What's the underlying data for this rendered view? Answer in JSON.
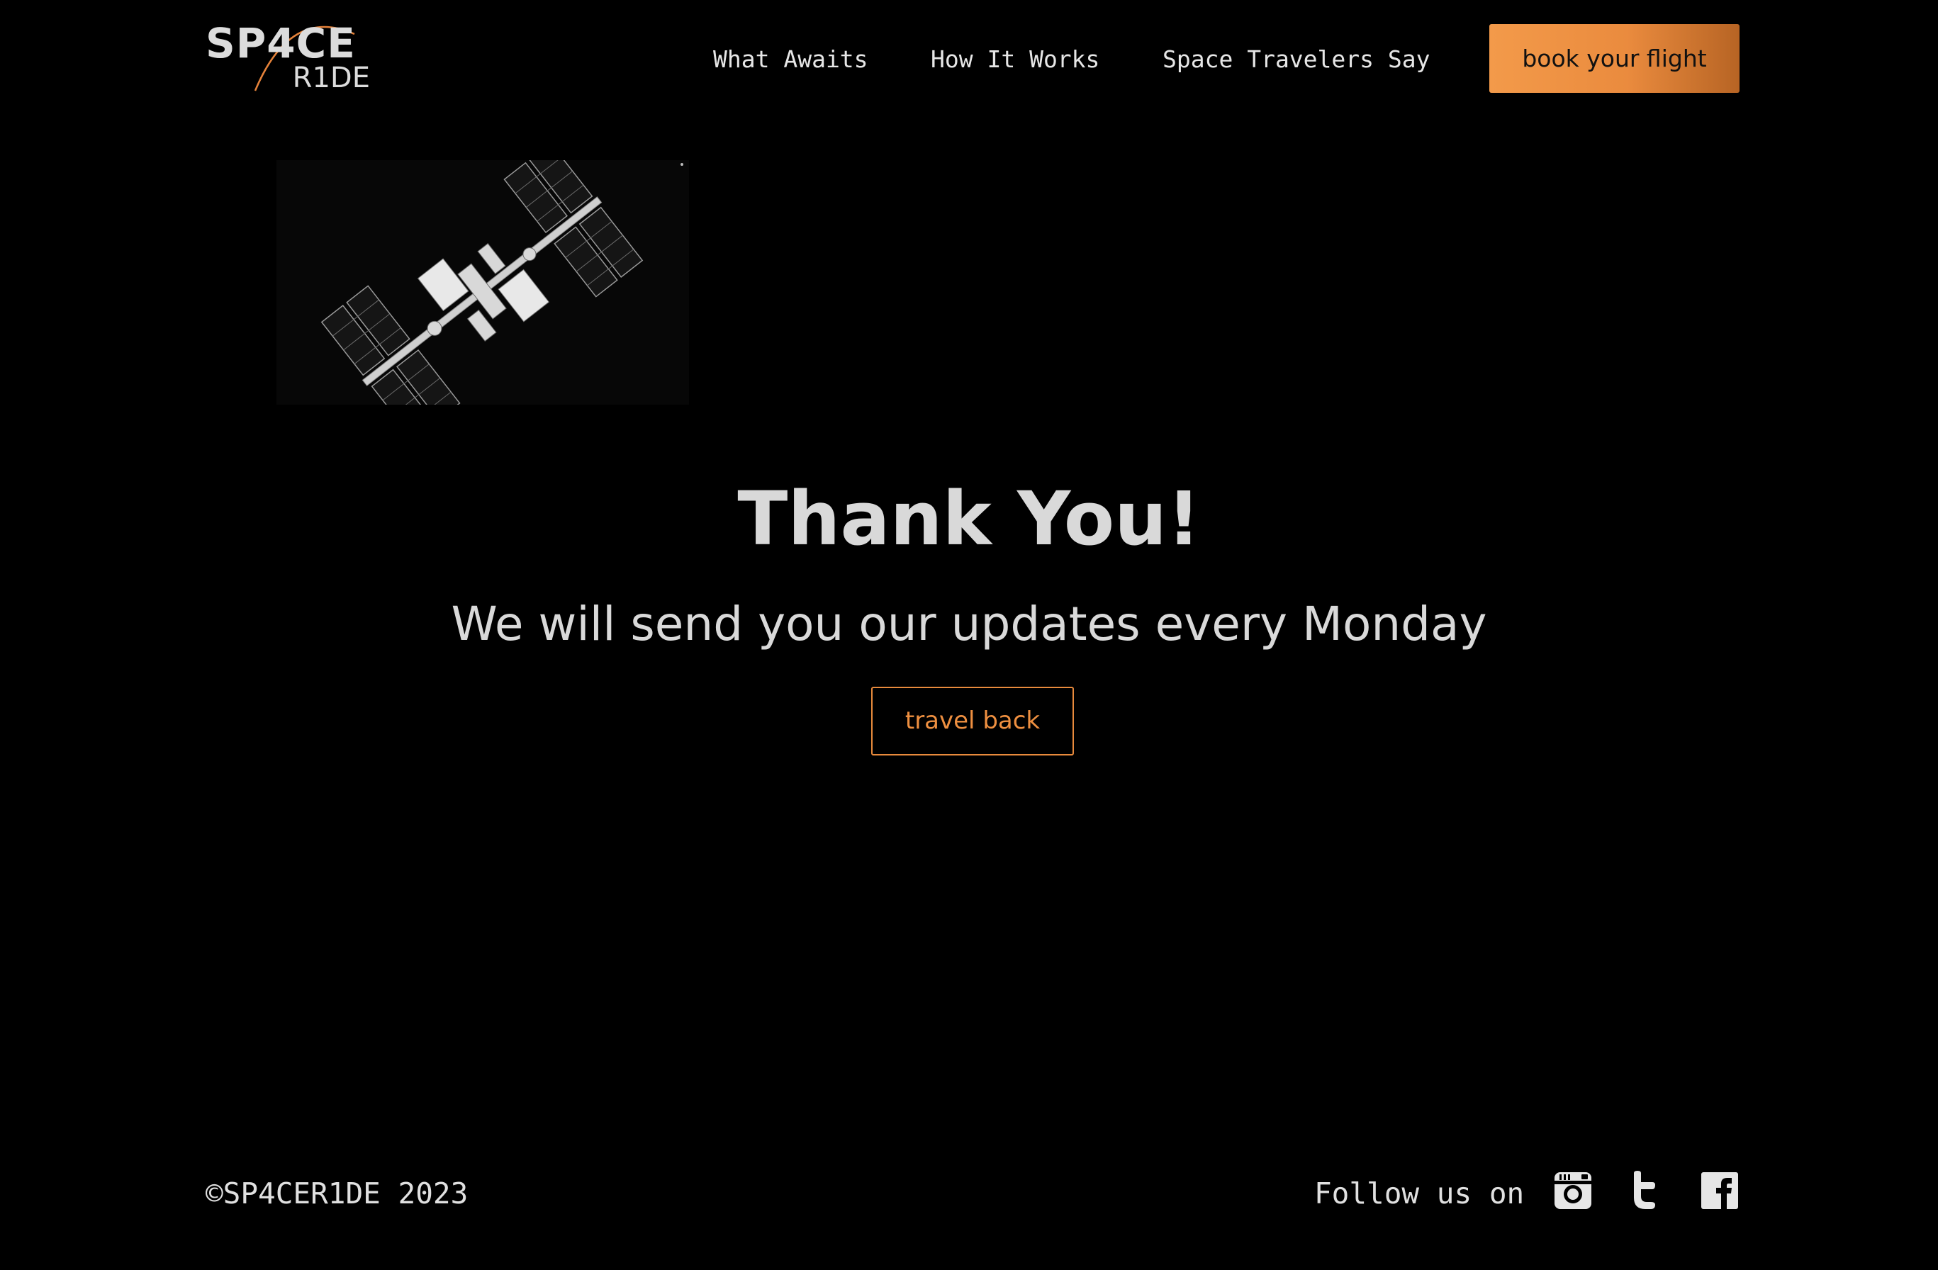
{
  "brand": {
    "logo_top": "SP4CE",
    "logo_bottom": "R1DE"
  },
  "nav": {
    "items": [
      "What Awaits",
      "How It Works",
      "Space Travelers Say"
    ],
    "cta_label": "book your flight"
  },
  "hero": {
    "image": "space-station-icon",
    "title": "Thank You!",
    "subtitle": "We will send you our updates every Monday",
    "button_label": "travel back"
  },
  "footer": {
    "copyright": "©SP4CER1DE 2023",
    "follow_label": "Follow us on",
    "social": [
      "instagram-icon",
      "twitter-icon",
      "facebook-icon"
    ]
  },
  "colors": {
    "background": "#000000",
    "accent": "#ee8f40",
    "text": "#d9d9d9"
  }
}
